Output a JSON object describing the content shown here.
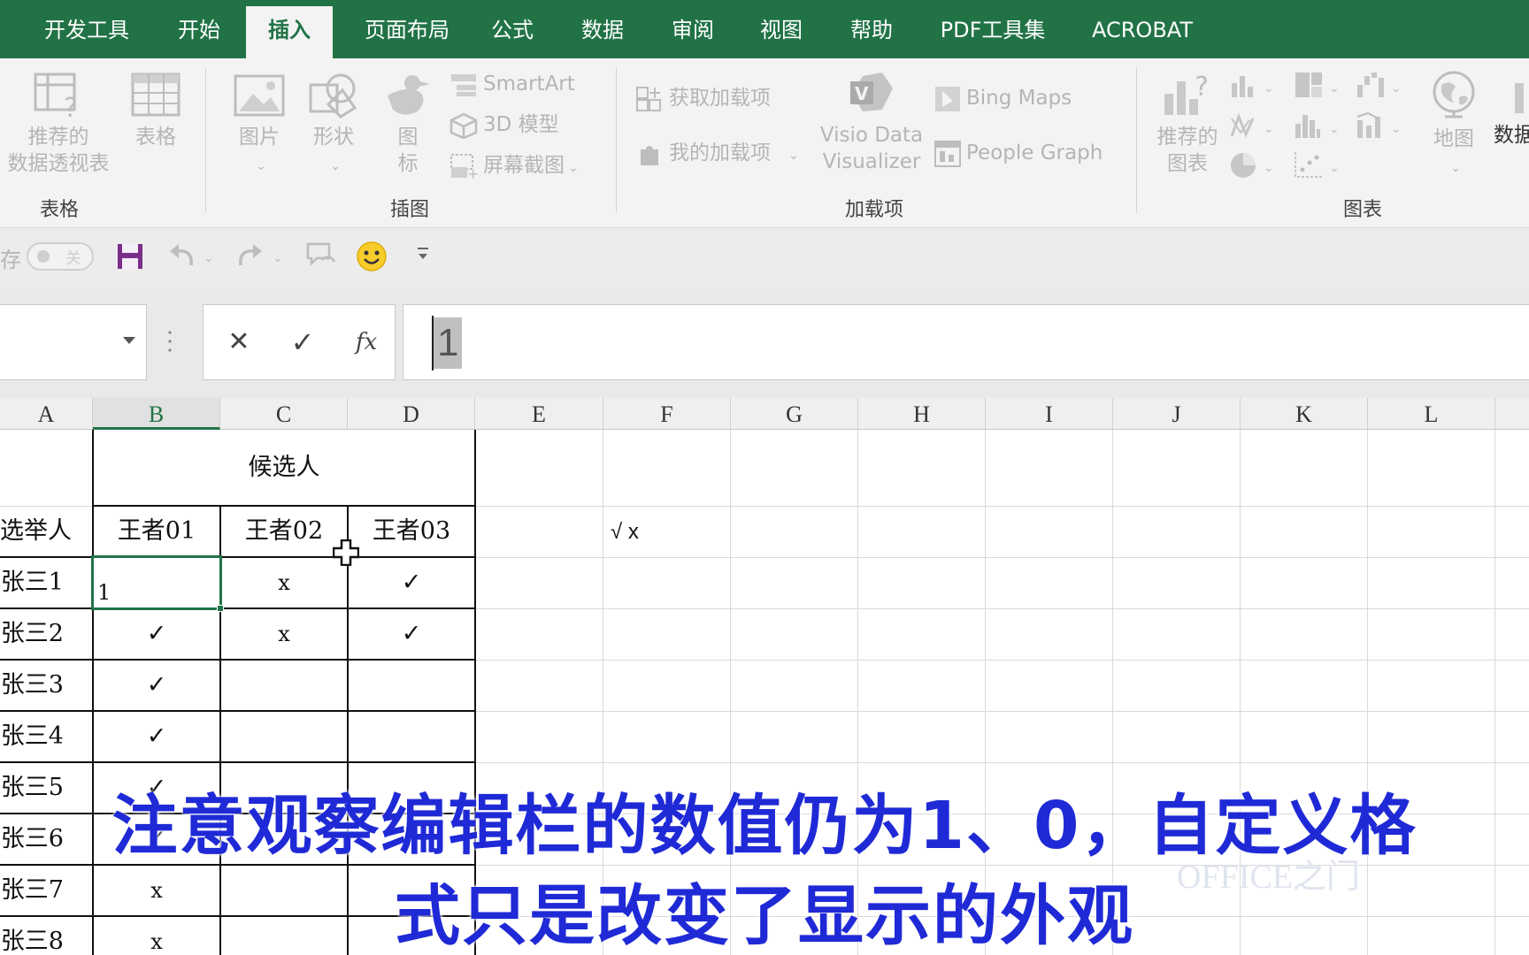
{
  "tabs": [
    {
      "label": "开发工具",
      "active": false
    },
    {
      "label": "开始",
      "active": false
    },
    {
      "label": "插入",
      "active": true
    },
    {
      "label": "页面布局",
      "active": false
    },
    {
      "label": "公式",
      "active": false
    },
    {
      "label": "数据",
      "active": false
    },
    {
      "label": "审阅",
      "active": false
    },
    {
      "label": "视图",
      "active": false
    },
    {
      "label": "帮助",
      "active": false
    },
    {
      "label": "PDF工具集",
      "active": false
    },
    {
      "label": "ACROBAT",
      "active": false
    }
  ],
  "ribbon": {
    "tables": {
      "group_label": "表格",
      "pivot_line1": "推荐的",
      "pivot_line2": "数据透视表",
      "table": "表格"
    },
    "illustrations": {
      "group_label": "插图",
      "picture": "图片",
      "shape": "形状",
      "icon_line1": "图",
      "icon_line2": "标",
      "smartart": "SmartArt",
      "model3d": "3D 模型",
      "screenshot": "屏幕截图"
    },
    "addins": {
      "group_label": "加载项",
      "get_addins": "获取加载项",
      "my_addins": "我的加载项",
      "visio_line1": "Visio Data",
      "visio_line2": "Visualizer",
      "bing_maps": "Bing Maps",
      "people_graph": "People Graph"
    },
    "charts": {
      "group_label": "图表",
      "recommended_line1": "推荐的",
      "recommended_line2": "图表",
      "map": "地图",
      "pivot_chart_partial": "数据"
    }
  },
  "qat": {
    "autosave_partial": "存",
    "toggle_state": "关"
  },
  "formula_bar": {
    "cancel": "✕",
    "enter": "✓",
    "fx": "fx",
    "value": "1"
  },
  "columns": [
    "A",
    "B",
    "C",
    "D",
    "E",
    "F",
    "G",
    "H",
    "I",
    "J",
    "K",
    "L"
  ],
  "selected_column": "B",
  "table": {
    "header_candidates": "候选人",
    "header_voter_partial": "选举人",
    "candidate_names": [
      "王者01",
      "王者02",
      "王者03"
    ],
    "rows": [
      {
        "voter": "张三1",
        "b": "1",
        "c": "x",
        "d": "✓"
      },
      {
        "voter": "张三2",
        "b": "✓",
        "c": "x",
        "d": "✓"
      },
      {
        "voter": "张三3",
        "b": "✓",
        "c": "",
        "d": ""
      },
      {
        "voter": "张三4",
        "b": "✓",
        "c": "",
        "d": ""
      },
      {
        "voter": "张三5",
        "b": "✓",
        "c": "",
        "d": ""
      },
      {
        "voter": "张三6",
        "b": "✓",
        "c": "",
        "d": ""
      },
      {
        "voter": "张三7",
        "b": "x",
        "c": "",
        "d": ""
      },
      {
        "voter": "张三8",
        "b": "x",
        "c": "",
        "d": ""
      }
    ]
  },
  "f_cell_text": "√ x",
  "subtitle": {
    "line1": "注意观察编辑栏的数值仍为1、0，自定义格",
    "line2": "式只是改变了显示的外观"
  },
  "watermark": "OFFICE之门",
  "colors": {
    "accent": "#217346",
    "subtitle": "#1f2ad6",
    "ribbon_bg": "#f3f3f3"
  }
}
